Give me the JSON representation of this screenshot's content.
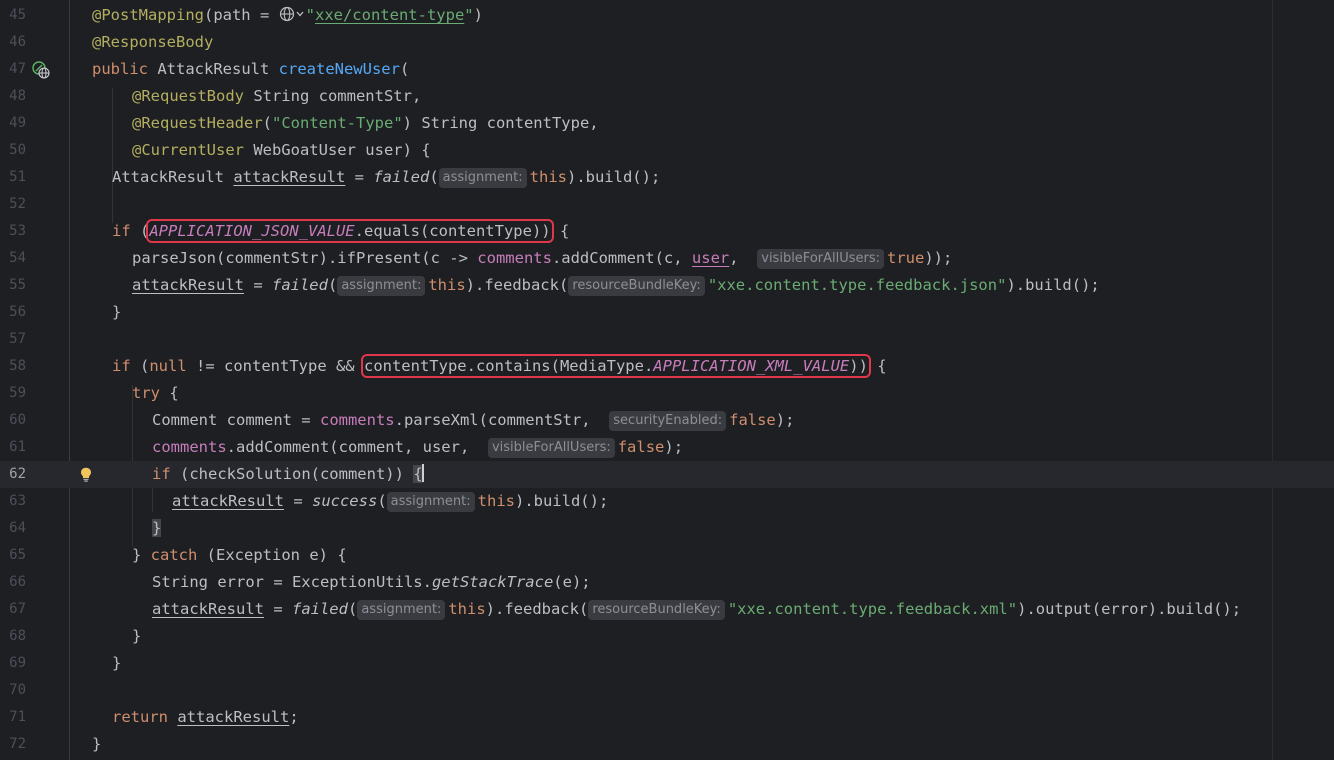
{
  "editor": {
    "lines": [
      {
        "n": "45"
      },
      {
        "n": "46"
      },
      {
        "n": "47"
      },
      {
        "n": "48"
      },
      {
        "n": "49"
      },
      {
        "n": "50"
      },
      {
        "n": "51"
      },
      {
        "n": "52"
      },
      {
        "n": "53"
      },
      {
        "n": "54"
      },
      {
        "n": "55"
      },
      {
        "n": "56"
      },
      {
        "n": "57"
      },
      {
        "n": "58"
      },
      {
        "n": "59"
      },
      {
        "n": "60"
      },
      {
        "n": "61"
      },
      {
        "n": "62"
      },
      {
        "n": "63"
      },
      {
        "n": "64"
      },
      {
        "n": "65"
      },
      {
        "n": "66"
      },
      {
        "n": "67"
      },
      {
        "n": "68"
      },
      {
        "n": "69"
      },
      {
        "n": "70"
      },
      {
        "n": "71"
      },
      {
        "n": "72"
      }
    ],
    "current_line": "62",
    "gutter_icons": {
      "line47": "endpoint-globe-icon",
      "line62": "lightbulb-icon"
    }
  },
  "code": {
    "l45": {
      "ann": "@PostMapping",
      "a": "(path = ",
      "icon": "globe-dropdown-icon",
      "q1": "\"",
      "url": "xxe/content-type",
      "q2": "\"",
      "b": ")"
    },
    "l46": {
      "ann": "@ResponseBody"
    },
    "l47": {
      "kw": "public",
      "a": " AttackResult ",
      "fn": "createNewUser",
      "b": "("
    },
    "l48": {
      "ann": "@RequestBody",
      "a": " String commentStr,"
    },
    "l49": {
      "ann": "@RequestHeader",
      "a": "(",
      "str": "\"Content-Type\"",
      "b": ") String contentType,"
    },
    "l50": {
      "ann": "@CurrentUser",
      "a": " WebGoatUser user) {"
    },
    "l51": {
      "a": "AttackResult ",
      "var": "attackResult",
      "b": " = ",
      "fn": "failed",
      "c": "(",
      "hint": "assignment:",
      "kw": "this",
      "d": ").build();"
    },
    "l53": {
      "kw": "if",
      "a": " (",
      "const": "APPLICATION_JSON_VALUE",
      "b": ".equals(contentType))",
      "c": " {"
    },
    "l54": {
      "a": "parseJson(commentStr).ifPresent(c -> ",
      "fld": "comments",
      "b": ".addComment(c, ",
      "var": "user",
      "c": ",  ",
      "hint": "visibleForAllUsers:",
      "kw": "true",
      "d": "));"
    },
    "l55": {
      "var": "attackResult",
      "a": " = ",
      "fn": "failed",
      "b": "(",
      "hint1": "assignment:",
      "kw": "this",
      "c": ").feedback(",
      "hint2": "resourceBundleKey:",
      "str": "\"xxe.content.type.feedback.json\"",
      "d": ").build();"
    },
    "l56": {
      "a": "}"
    },
    "l58": {
      "kw1": "if",
      "a": " (",
      "kw2": "null",
      "b": " != contentType && ",
      "c": "contentType.contains(MediaType.",
      "const": "APPLICATION_XML_VALUE",
      "d": "))",
      "e": " {"
    },
    "l59": {
      "kw": "try",
      "a": " {"
    },
    "l60": {
      "a": "Comment comment = ",
      "fld": "comments",
      "b": ".parseXml(commentStr,  ",
      "hint": "securityEnabled:",
      "kw": "false",
      "c": ");"
    },
    "l61": {
      "fld": "comments",
      "a": ".addComment(comment, user,  ",
      "hint": "visibleForAllUsers:",
      "kw": "false",
      "b": ");"
    },
    "l62": {
      "kw": "if",
      "a": " (checkSolution(comment)) ",
      "b": "{"
    },
    "l63": {
      "var": "attackResult",
      "a": " = ",
      "fn": "success",
      "b": "(",
      "hint": "assignment:",
      "kw": "this",
      "c": ").build();"
    },
    "l64": {
      "a": "}"
    },
    "l65": {
      "a": "} ",
      "kw": "catch",
      "b": " (Exception e) {"
    },
    "l66": {
      "a": "String error = ExceptionUtils.",
      "fn": "getStackTrace",
      "b": "(e);"
    },
    "l67": {
      "var": "attackResult",
      "a": " = ",
      "fn": "failed",
      "b": "(",
      "hint1": "assignment:",
      "kw": "this",
      "c": ").feedback(",
      "hint2": "resourceBundleKey:",
      "str": "\"xxe.content.type.feedback.xml\"",
      "d": ").output(error).build();"
    },
    "l68": {
      "a": "}"
    },
    "l69": {
      "a": "}"
    },
    "l71": {
      "kw": "return",
      "a": " ",
      "var": "attackResult",
      "b": ";"
    },
    "l72": {
      "a": "}"
    }
  },
  "colors": {
    "background": "#1e1f22",
    "keyword": "#cf8e6d",
    "annotation": "#b3ae60",
    "string": "#6aab73",
    "function": "#56a8f5",
    "field": "#c77dbb",
    "highlight_box": "#e0384a"
  }
}
